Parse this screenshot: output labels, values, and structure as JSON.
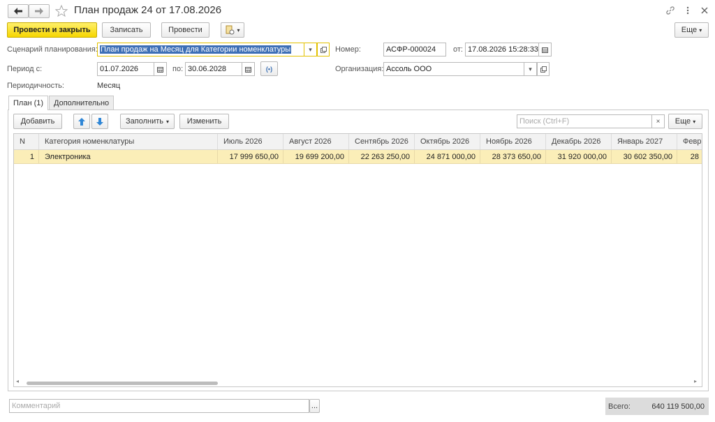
{
  "window": {
    "title": "План продаж 24 от 17.08.2026"
  },
  "toolbar": {
    "post_close": "Провести и закрыть",
    "save": "Записать",
    "post": "Провести",
    "more": "Еще"
  },
  "form": {
    "scenario_label": "Сценарий планирования:",
    "scenario_value": "План продаж на Месяц для Категории номенклатуры",
    "number_label": "Номер:",
    "number_value": "АСФР-000024",
    "date_label": "от:",
    "date_value": "17.08.2026 15:28:33",
    "period_label": "Период с:",
    "period_from": "01.07.2026",
    "period_to_label": "по:",
    "period_to": "30.06.2028",
    "org_label": "Организация:",
    "org_value": "Ассоль ООО",
    "periodicity_label": "Периодичность:",
    "periodicity_value": "Месяц"
  },
  "tabs": [
    {
      "label": "План (1)",
      "active": true
    },
    {
      "label": "Дополнительно",
      "active": false
    }
  ],
  "table_toolbar": {
    "add": "Добавить",
    "fill": "Заполнить",
    "edit": "Изменить",
    "search_placeholder": "Поиск (Ctrl+F)",
    "more": "Еще"
  },
  "table": {
    "columns": [
      "N",
      "Категория номенклатуры",
      "Июль 2026",
      "Август 2026",
      "Сентябрь 2026",
      "Октябрь 2026",
      "Ноябрь 2026",
      "Декабрь 2026",
      "Январь 2027",
      "Февр"
    ],
    "rows": [
      [
        "1",
        "Электроника",
        "17 999 650,00",
        "19 699 200,00",
        "22 263 250,00",
        "24 871 000,00",
        "28 373 650,00",
        "31 920 000,00",
        "30 602 350,00",
        "28"
      ]
    ]
  },
  "footer": {
    "comment_placeholder": "Комментарий",
    "ellipsis": "...",
    "total_label": "Всего:",
    "total_value": "640 119 500,00"
  },
  "colors": {
    "primary_button": "#f6d600",
    "selected_row": "#fbeeb8",
    "selection": "#3d6fb6"
  }
}
